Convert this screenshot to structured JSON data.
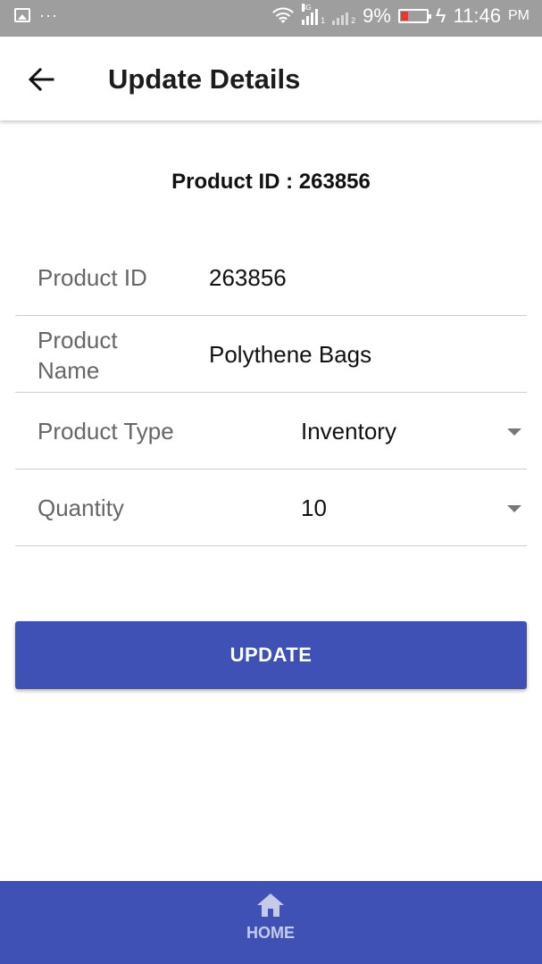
{
  "status_bar": {
    "battery_percent": "9%",
    "time": "11:46",
    "ampm": "PM",
    "network_label": "4G",
    "sim1": "1",
    "sim2": "2"
  },
  "app_bar": {
    "title": "Update Details",
    "back_icon": "arrow-left-icon"
  },
  "heading": "Product ID : 263856",
  "form": {
    "product_id": {
      "label": "Product ID",
      "value": "263856"
    },
    "product_name": {
      "label": "Product\nName",
      "value": "Polythene Bags"
    },
    "product_type": {
      "label": "Product Type",
      "value": "Inventory"
    },
    "quantity": {
      "label": "Quantity",
      "value": "10"
    }
  },
  "update_button": "UPDATE",
  "bottom_nav": {
    "home_label": "HOME",
    "home_icon": "home-icon"
  },
  "colors": {
    "primary": "#3f51b5",
    "status_bar": "#9e9e9e",
    "battery_low": "#e53935"
  }
}
